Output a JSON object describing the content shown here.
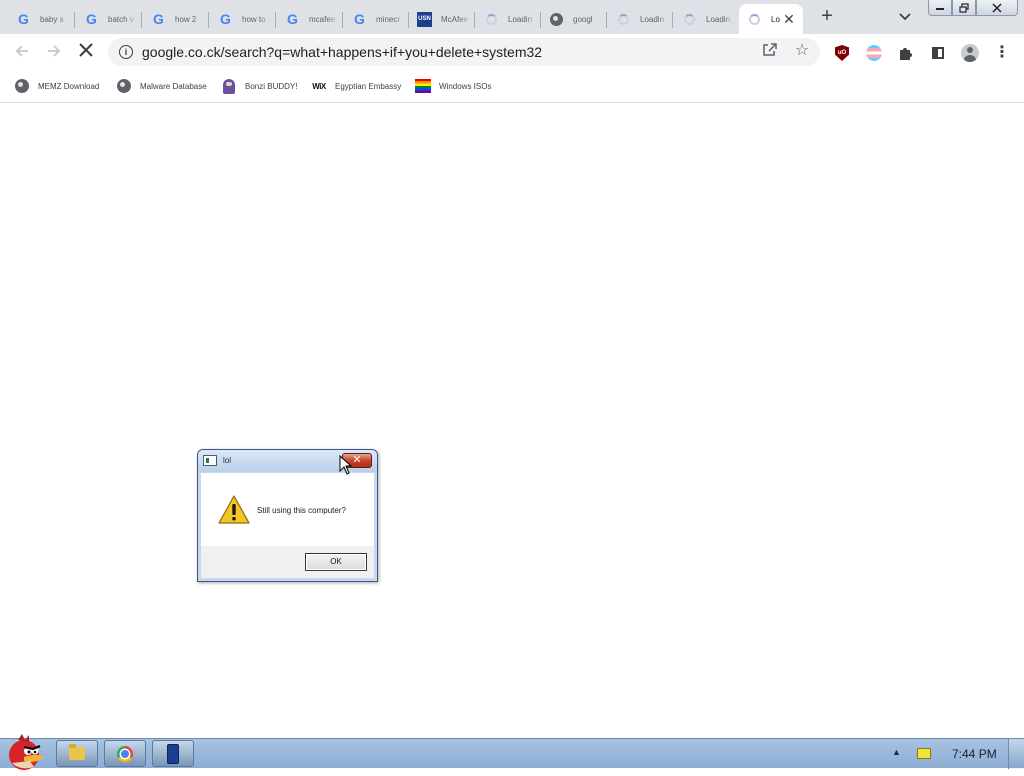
{
  "browser": {
    "tabs": [
      {
        "title": "baby s",
        "icon": "google-g-icon"
      },
      {
        "title": "batch v",
        "icon": "google-g-icon"
      },
      {
        "title": "how 2",
        "icon": "google-g-icon"
      },
      {
        "title": "how to",
        "icon": "google-g-icon"
      },
      {
        "title": "mcafee",
        "icon": "google-g-icon"
      },
      {
        "title": "minecr",
        "icon": "google-g-icon"
      },
      {
        "title": "McAfee",
        "icon": "usn-icon"
      },
      {
        "title": "Loadin",
        "icon": "loading-spinner-icon"
      },
      {
        "title": "googl",
        "icon": "globe-icon"
      },
      {
        "title": "Loadin",
        "icon": "loading-spinner-icon"
      },
      {
        "title": "Loadin",
        "icon": "loading-spinner-icon"
      },
      {
        "title": "Lo",
        "icon": "loading-spinner-icon",
        "active": true
      }
    ],
    "address": {
      "url": "google.co.ck/search?q=what+happens+if+you+delete+system32"
    },
    "bookmarks": [
      {
        "label": "MEMZ Download",
        "icon": "globe-icon"
      },
      {
        "label": "Malware Database",
        "icon": "globe-icon"
      },
      {
        "label": "Bonzi BUDDY!",
        "icon": "bonzi-icon"
      },
      {
        "label": "Egyptian Embassy",
        "icon": "wix-icon"
      },
      {
        "label": "Windows ISOs",
        "icon": "rainbow-flag-icon"
      }
    ],
    "extensions": [
      "ublock-icon",
      "pride-flag-icon",
      "puzzle-icon",
      "side-panel-icon",
      "profile-icon"
    ]
  },
  "dialog": {
    "title": "lol",
    "message": "Still using this computer?",
    "ok_label": "OK",
    "close_glyph": "✕",
    "icon": "warning-icon"
  },
  "taskbar": {
    "items": [
      "folder-icon",
      "chrome-icon",
      "phone-icon"
    ],
    "clock": "7:44 PM"
  },
  "colors": {
    "tabstrip": "#dee1e6",
    "taskbar": "#8eaed4",
    "dialog_close": "#c7452a"
  }
}
